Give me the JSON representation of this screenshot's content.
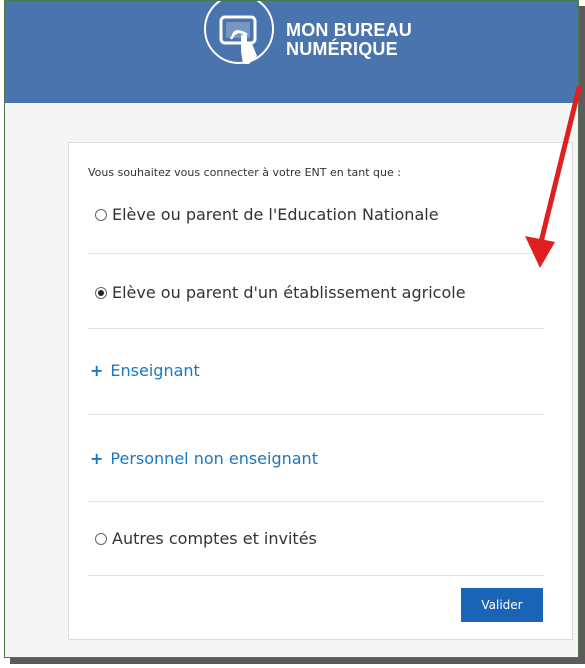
{
  "header": {
    "logo_line1": "MON BUREAU",
    "logo_line2": "NUMÉRIQUE",
    "background_color": "#4a74ad"
  },
  "form": {
    "intro": "Vous souhaitez vous connecter à votre ENT en tant que :",
    "options": [
      {
        "label": "Elève ou parent de l'Education Nationale",
        "type": "radio",
        "checked": false
      },
      {
        "label": "Elève ou parent d'un établissement agricole",
        "type": "radio",
        "checked": true
      },
      {
        "label": "Enseignant",
        "type": "expandable",
        "prefix": "+"
      },
      {
        "label": "Personnel non enseignant",
        "type": "expandable",
        "prefix": "+"
      },
      {
        "label": "Autres comptes et invités",
        "type": "radio",
        "checked": false
      }
    ],
    "submit_label": "Valider",
    "accent_color": "#1a78c2",
    "button_color": "#1a64b7"
  },
  "annotation": {
    "arrow_color": "#e02020",
    "icon": "red-arrow-icon"
  }
}
